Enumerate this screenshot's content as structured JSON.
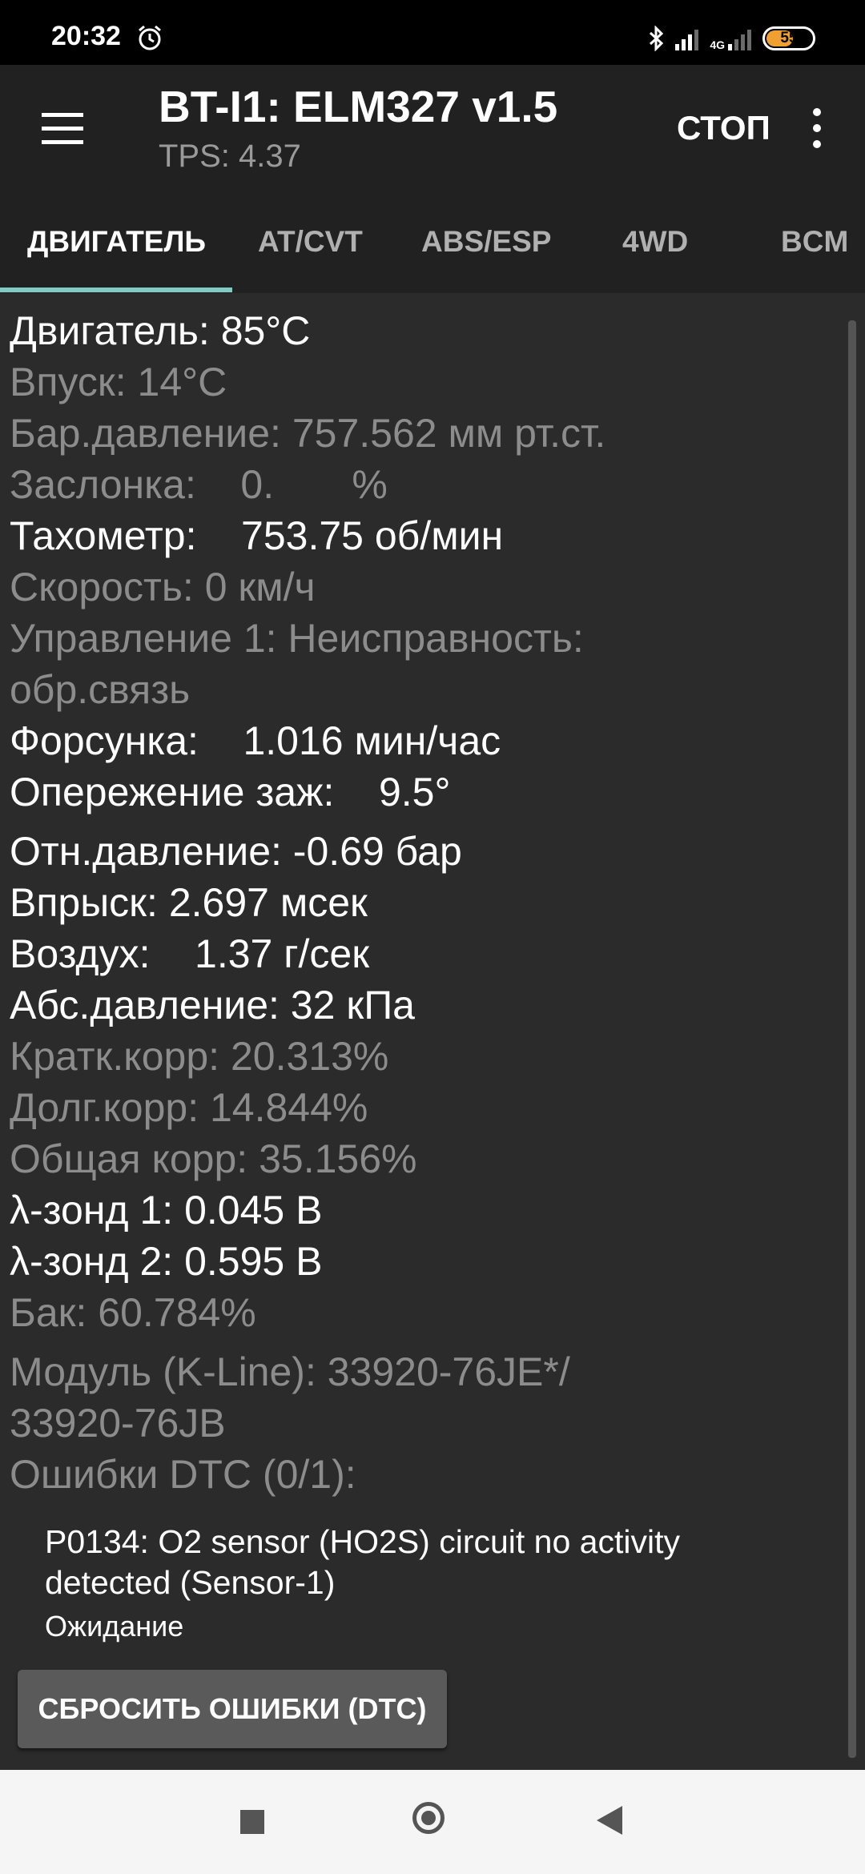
{
  "status_bar": {
    "time": "20:32",
    "network_label": "4G",
    "battery": "55",
    "battery_color": "#f0a030"
  },
  "app_bar": {
    "title": "BT-I1: ELM327 v1.5",
    "subtitle": "TPS: 4.37",
    "stop_label": "СТОП",
    "menu_icon": "hamburger-icon",
    "overflow_icon": "more-vert-icon"
  },
  "tabs": [
    {
      "label": "ДВИГАТЕЛЬ",
      "active": true
    },
    {
      "label": "AT/CVT",
      "active": false
    },
    {
      "label": "ABS/ESP",
      "active": false
    },
    {
      "label": "4WD",
      "active": false
    },
    {
      "label": "BCM",
      "active": false
    }
  ],
  "accent_color": "#80cbc4",
  "readings": [
    {
      "text": "Двигатель: 85°C",
      "dim": false
    },
    {
      "text": "Впуск: 14°C",
      "dim": true
    },
    {
      "text": "Бар.давление: 757.562 мм рт.ст.",
      "dim": true
    },
    {
      "text": "Заслонка:    0.       %",
      "dim": true
    },
    {
      "text": "Тахометр:    753.75 об/мин",
      "dim": false
    },
    {
      "text": "Скорость: 0 км/ч",
      "dim": true
    },
    {
      "text": "Управление 1: Неисправность:",
      "dim": true
    },
    {
      "text": "обр.связь",
      "dim": true
    },
    {
      "text": "Форсунка:    1.016 мин/час",
      "dim": false
    },
    {
      "text": "Опережение заж:    9.5°",
      "dim": false
    },
    {
      "text": "Отн.давление: -0.69 бар",
      "dim": false
    },
    {
      "text": "Впрыск: 2.697 мсек",
      "dim": false
    },
    {
      "text": "Воздух:    1.37 г/сек",
      "dim": false
    },
    {
      "text": "Абс.давление: 32 кПа",
      "dim": false
    },
    {
      "text": "Кратк.корр: 20.313%",
      "dim": true
    },
    {
      "text": "Долг.корр: 14.844%",
      "dim": true
    },
    {
      "text": "Общая корр: 35.156%",
      "dim": true
    },
    {
      "text": "λ-зонд 1: 0.045 В",
      "dim": false
    },
    {
      "text": "λ-зонд 2: 0.595 В",
      "dim": false
    },
    {
      "text": "Бак: 60.784%",
      "dim": true
    },
    {
      "text": "Модуль (K-Line): 33920-76JE*/",
      "dim": true
    },
    {
      "text": "33920-76JB",
      "dim": true
    },
    {
      "text": "Ошибки DTC (0/1):",
      "dim": true
    }
  ],
  "dtc": {
    "code_line_1": "P0134: O2 sensor (HO2S) circuit no activity",
    "code_line_2": "detected (Sensor-1)",
    "status": "Ожидание"
  },
  "reset_button_label": "СБРОСИТЬ ОШИБКИ (DTC)"
}
